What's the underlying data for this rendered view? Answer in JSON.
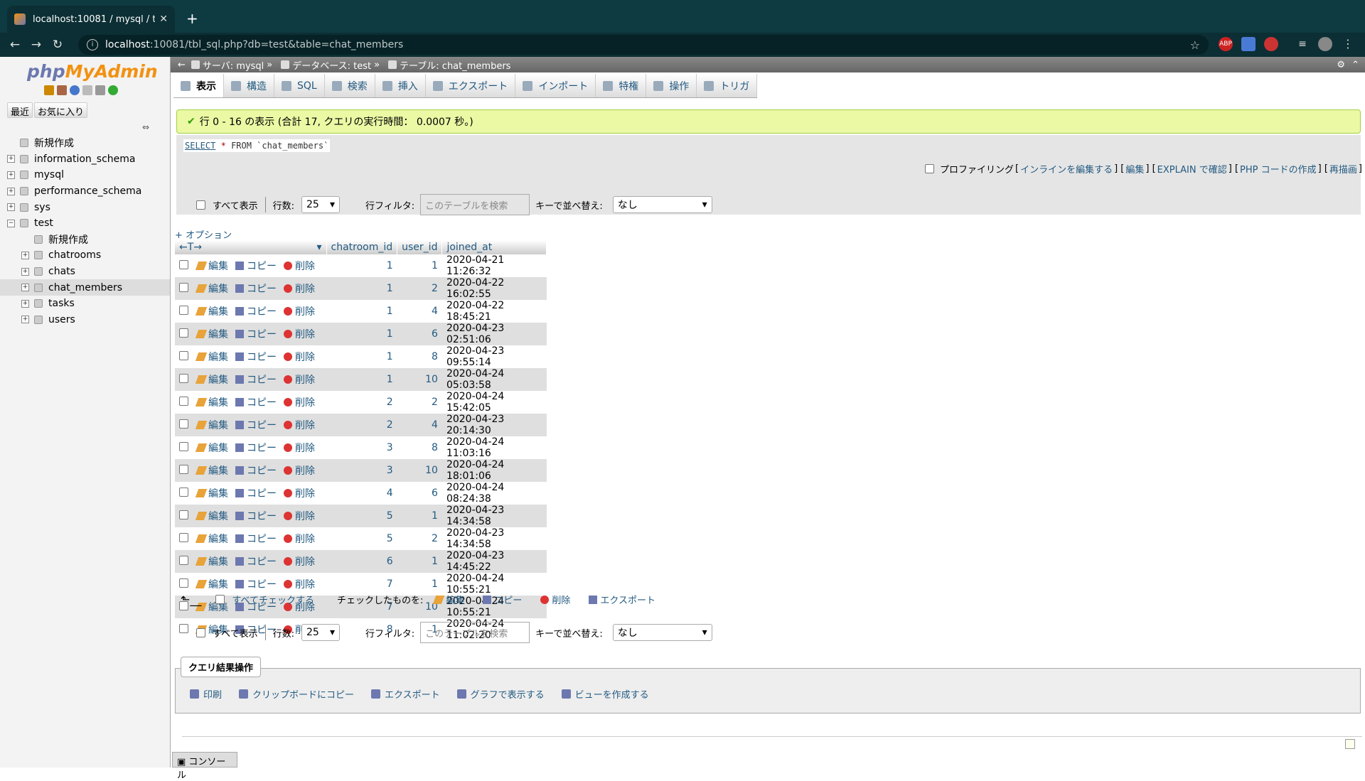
{
  "browser": {
    "tab_title": "localhost:10081 / mysql / test / chat_members",
    "url_host": "localhost",
    "url_rest": ":10081/tbl_sql.php?db=test&table=chat_members",
    "new_tab": "+",
    "ext_abp": "ABP"
  },
  "sidebar": {
    "logo_php": "php",
    "logo_myadmin": "MyAdmin",
    "recent": "最近",
    "favorites": "お気に入り",
    "tree": [
      {
        "label": "新規作成",
        "level": 0
      },
      {
        "label": "information_schema",
        "level": 0
      },
      {
        "label": "mysql",
        "level": 0
      },
      {
        "label": "performance_schema",
        "level": 0
      },
      {
        "label": "sys",
        "level": 0
      },
      {
        "label": "test",
        "level": 0
      },
      {
        "label": "新規作成",
        "level": 1
      },
      {
        "label": "chatrooms",
        "level": 1
      },
      {
        "label": "chats",
        "level": 1
      },
      {
        "label": "chat_members",
        "level": 1
      },
      {
        "label": "tasks",
        "level": 1
      },
      {
        "label": "users",
        "level": 1
      }
    ]
  },
  "breadcrumb": {
    "server": "サーバ: mysql",
    "database": "データベース: test",
    "table": "テーブル: chat_members"
  },
  "tabs": [
    {
      "label": "表示",
      "active": true
    },
    {
      "label": "構造"
    },
    {
      "label": "SQL"
    },
    {
      "label": "検索"
    },
    {
      "label": "挿入"
    },
    {
      "label": "エクスポート"
    },
    {
      "label": "インポート"
    },
    {
      "label": "特権"
    },
    {
      "label": "操作"
    },
    {
      "label": "トリガ"
    }
  ],
  "message": "行 0 - 16 の表示 (合計 17, クエリの実行時間： 0.0007 秒。)",
  "sql": {
    "select": "SELECT",
    "star": "*",
    "rest": "FROM `chat_members`"
  },
  "sql_links": {
    "profiling": "プロファイリング",
    "inline": "インラインを編集する",
    "edit": "編集",
    "explain": "EXPLAIN で確認",
    "php": "PHP コードの作成",
    "refresh": "再描画"
  },
  "nav": {
    "show_all": "すべて表示",
    "rows_label": "行数:",
    "rows_value": "25",
    "filter_label": "行フィルタ:",
    "filter_placeholder": "このテーブルを検索",
    "sort_label": "キーで並べ替え:",
    "sort_value": "なし"
  },
  "options_link": "+ オプション",
  "columns": [
    "chatroom_id",
    "user_id",
    "joined_at"
  ],
  "actions": {
    "edit": "編集",
    "copy": "コピー",
    "delete": "削除"
  },
  "rows": [
    [
      1,
      1,
      "2020-04-21 11:26:32"
    ],
    [
      1,
      2,
      "2020-04-22 16:02:55"
    ],
    [
      1,
      4,
      "2020-04-22 18:45:21"
    ],
    [
      1,
      6,
      "2020-04-23 02:51:06"
    ],
    [
      1,
      8,
      "2020-04-23 09:55:14"
    ],
    [
      1,
      10,
      "2020-04-24 05:03:58"
    ],
    [
      2,
      2,
      "2020-04-24 15:42:05"
    ],
    [
      2,
      4,
      "2020-04-23 20:14:30"
    ],
    [
      3,
      8,
      "2020-04-24 11:03:16"
    ],
    [
      3,
      10,
      "2020-04-24 18:01:06"
    ],
    [
      4,
      6,
      "2020-04-24 08:24:38"
    ],
    [
      5,
      1,
      "2020-04-23 14:34:58"
    ],
    [
      5,
      2,
      "2020-04-23 14:34:58"
    ],
    [
      6,
      1,
      "2020-04-23 14:45:22"
    ],
    [
      7,
      1,
      "2020-04-24 10:55:21"
    ],
    [
      7,
      10,
      "2020-04-24 10:55:21"
    ],
    [
      8,
      1,
      "2020-04-24 11:02:20"
    ]
  ],
  "bulk": {
    "check_all": "すべてチェックする",
    "with_selected": "チェックしたものを:",
    "edit": "編集",
    "copy": "コピー",
    "delete": "削除",
    "export": "エクスポート"
  },
  "result_ops": {
    "title": "クエリ結果操作",
    "print": "印刷",
    "clipboard": "クリップボードにコピー",
    "export": "エクスポート",
    "chart": "グラフで表示する",
    "view": "ビューを作成する"
  },
  "console": "コンソール"
}
